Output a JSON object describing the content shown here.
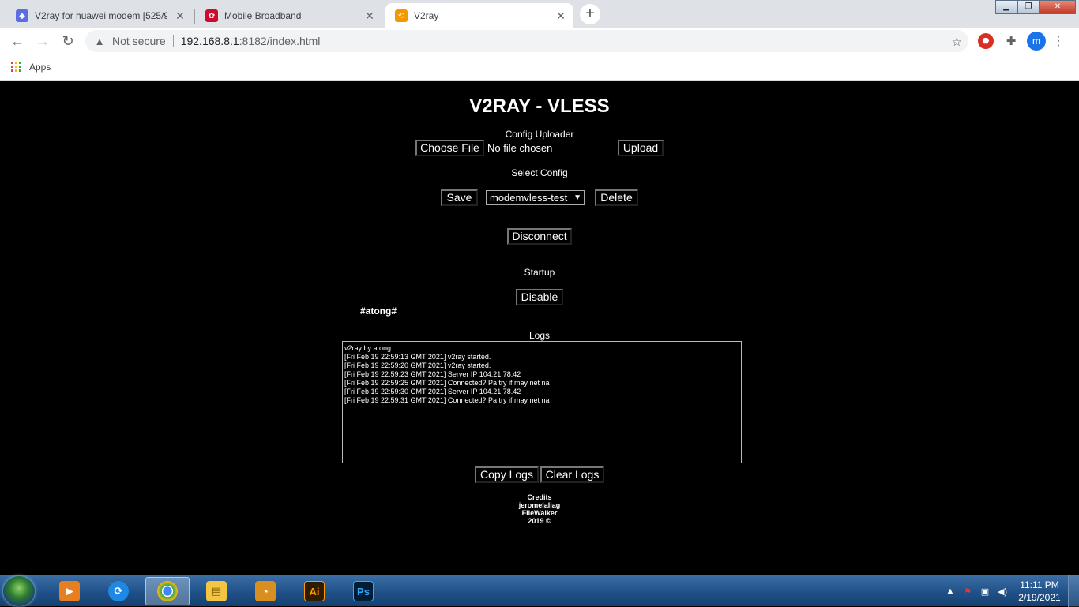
{
  "browser": {
    "tabs": [
      {
        "title": "V2ray for huawei modem [525/9",
        "icon": "vpn-shield-icon",
        "color": "#5b6ee1"
      },
      {
        "title": "Mobile Broadband",
        "icon": "huawei-logo-icon",
        "color": "#cf0a2c"
      },
      {
        "title": "V2ray",
        "icon": "v2ray-logo-icon",
        "color": "#f29900"
      }
    ],
    "security_label": "Not secure",
    "url_host": "192.168.8.1",
    "url_rest": ":8182/index.html",
    "bookmarks": {
      "apps_label": "Apps"
    },
    "avatar_letter": "m"
  },
  "page": {
    "title": "V2RAY - VLESS",
    "uploader": {
      "label": "Config Uploader",
      "choose_file": "Choose File",
      "no_file": "No file chosen",
      "upload": "Upload"
    },
    "select_config": {
      "label": "Select Config",
      "save": "Save",
      "selected": "modemvless-test",
      "delete": "Delete"
    },
    "disconnect": "Disconnect",
    "startup": {
      "label": "Startup",
      "button": "Disable"
    },
    "tag": "#atong#",
    "logs": {
      "label": "Logs",
      "lines": [
        "v2ray by atong",
        "[Fri Feb 19 22:59:13 GMT 2021] v2ray started.",
        "[Fri Feb 19 22:59:20 GMT 2021] v2ray started.",
        "[Fri Feb 19 22:59:23 GMT 2021] Server IP 104.21.78.42",
        "[Fri Feb 19 22:59:25 GMT 2021] Connected? Pa try if may net na",
        "[Fri Feb 19 22:59:30 GMT 2021] Server IP 104.21.78.42",
        "[Fri Feb 19 22:59:31 GMT 2021] Connected? Pa try if may net na"
      ],
      "copy": "Copy Logs",
      "clear": "Clear Logs"
    },
    "credits": [
      "Credits",
      "jeromelaliag",
      "FileWalker",
      "2019 ©"
    ]
  },
  "taskbar": {
    "apps": [
      {
        "name": "media-player-icon",
        "color": "#e67e22"
      },
      {
        "name": "sync-center-icon",
        "color": "#1e88e5"
      },
      {
        "name": "chrome-icon",
        "color": "#34a853"
      },
      {
        "name": "file-explorer-icon",
        "color": "#f4c542"
      },
      {
        "name": "app-launcher-icon",
        "color": "#d98f1f"
      },
      {
        "name": "illustrator-icon",
        "label": "Ai",
        "color": "#ff9a00"
      },
      {
        "name": "photoshop-icon",
        "label": "Ps",
        "color": "#31a8ff"
      }
    ],
    "time": "11:11 PM",
    "date": "2/19/2021"
  }
}
